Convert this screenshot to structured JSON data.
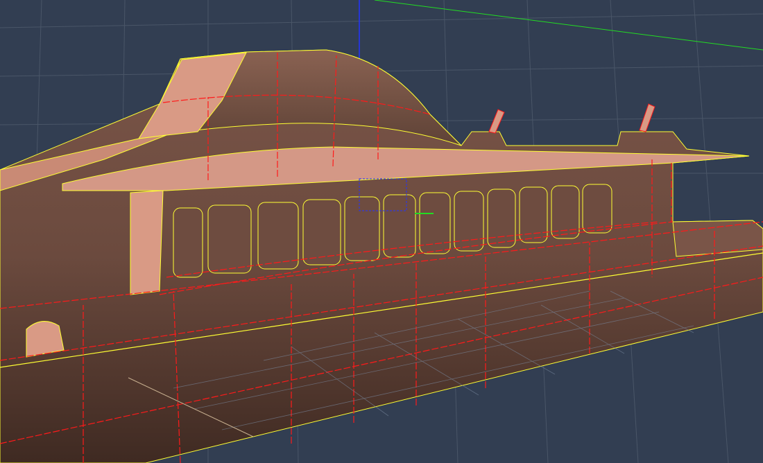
{
  "viewport": {
    "view": "perspective",
    "colors": {
      "background": "#323e52",
      "grid": "#4a5668",
      "hull_light": "#d99a85",
      "hull_dark": "#4a3028",
      "edge": "#ff1a1a",
      "boundary": "#ffff33",
      "axis_x": "#22dd22",
      "axis_z": "#2233ff"
    },
    "window_count": 12
  }
}
